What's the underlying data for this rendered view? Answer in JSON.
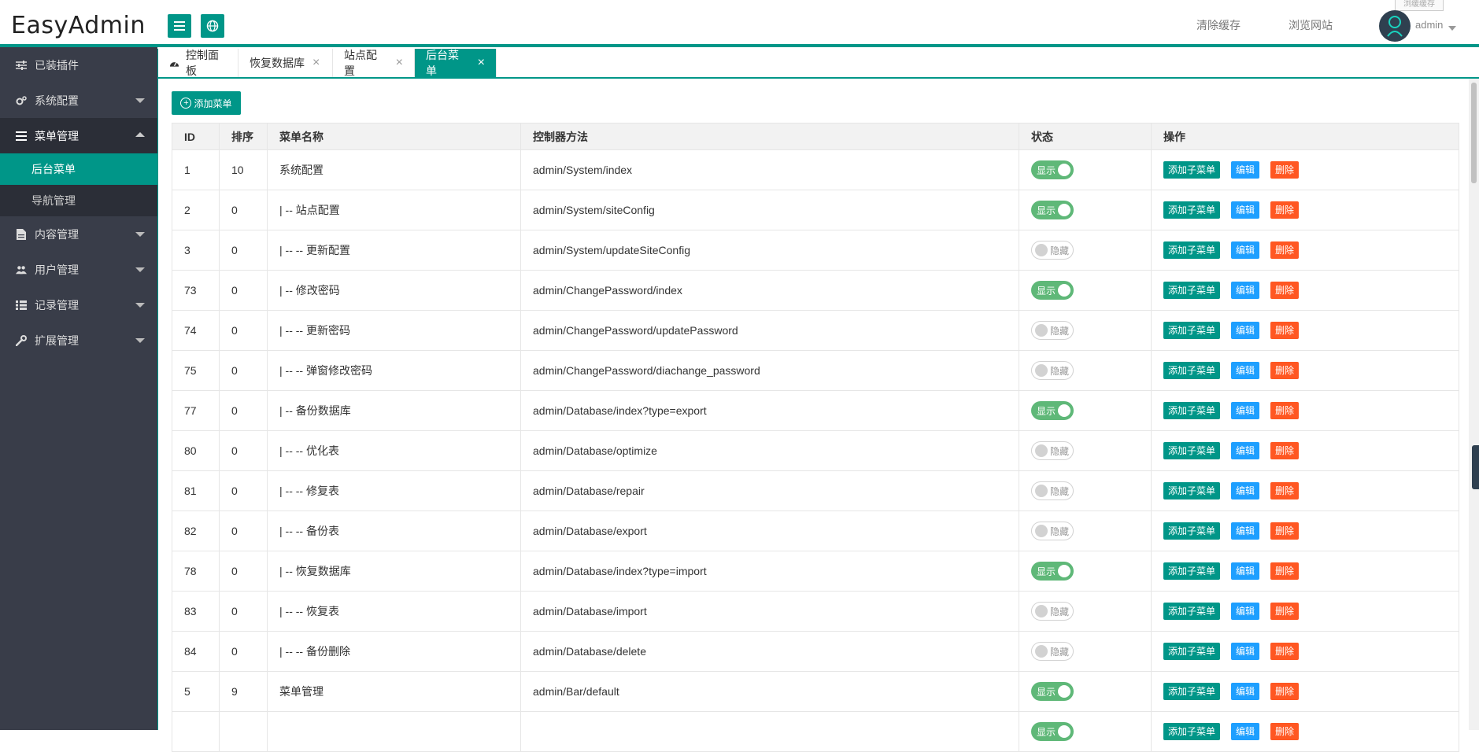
{
  "header": {
    "logo": "EasyAdmin",
    "clear_cache": "清除缓存",
    "browse_site": "浏览网站",
    "username": "admin",
    "tooltip": "浏缓缓存"
  },
  "sidebar": {
    "items": [
      {
        "label": "已装插件",
        "icon": "sliders-icon"
      },
      {
        "label": "系统配置",
        "icon": "gears-icon"
      },
      {
        "label": "菜单管理",
        "icon": "bars-icon"
      },
      {
        "label": "内容管理",
        "icon": "file-icon"
      },
      {
        "label": "用户管理",
        "icon": "users-icon"
      },
      {
        "label": "记录管理",
        "icon": "grid-icon"
      },
      {
        "label": "扩展管理",
        "icon": "wrench-icon"
      }
    ],
    "sub_items": [
      {
        "label": "后台菜单"
      },
      {
        "label": "导航管理"
      }
    ]
  },
  "tabs": [
    {
      "label": "控制面板"
    },
    {
      "label": "恢复数据库"
    },
    {
      "label": "站点配置"
    },
    {
      "label": "后台菜单"
    }
  ],
  "toolbar": {
    "add_menu": "添加菜单"
  },
  "table": {
    "headers": [
      "ID",
      "排序",
      "菜单名称",
      "控制器方法",
      "状态",
      "操作"
    ],
    "switch_on": "显示",
    "switch_off": "隐藏",
    "actions": {
      "add_child": "添加子菜单",
      "edit": "编辑",
      "delete": "删除"
    },
    "rows": [
      {
        "id": "1",
        "sort": "10",
        "name": "系统配置",
        "method": "admin/System/index",
        "on": true
      },
      {
        "id": "2",
        "sort": "0",
        "name": "| -- 站点配置",
        "method": "admin/System/siteConfig",
        "on": true
      },
      {
        "id": "3",
        "sort": "0",
        "name": "| -- -- 更新配置",
        "method": "admin/System/updateSiteConfig",
        "on": false
      },
      {
        "id": "73",
        "sort": "0",
        "name": "| -- 修改密码",
        "method": "admin/ChangePassword/index",
        "on": true
      },
      {
        "id": "74",
        "sort": "0",
        "name": "| -- -- 更新密码",
        "method": "admin/ChangePassword/updatePassword",
        "on": false
      },
      {
        "id": "75",
        "sort": "0",
        "name": "| -- -- 弹窗修改密码",
        "method": "admin/ChangePassword/diachange_password",
        "on": false
      },
      {
        "id": "77",
        "sort": "0",
        "name": "| -- 备份数据库",
        "method": "admin/Database/index?type=export",
        "on": true
      },
      {
        "id": "80",
        "sort": "0",
        "name": "| -- -- 优化表",
        "method": "admin/Database/optimize",
        "on": false
      },
      {
        "id": "81",
        "sort": "0",
        "name": "| -- -- 修复表",
        "method": "admin/Database/repair",
        "on": false
      },
      {
        "id": "82",
        "sort": "0",
        "name": "| -- -- 备份表",
        "method": "admin/Database/export",
        "on": false
      },
      {
        "id": "78",
        "sort": "0",
        "name": "| -- 恢复数据库",
        "method": "admin/Database/index?type=import",
        "on": true
      },
      {
        "id": "83",
        "sort": "0",
        "name": "| -- -- 恢复表",
        "method": "admin/Database/import",
        "on": false
      },
      {
        "id": "84",
        "sort": "0",
        "name": "| -- -- 备份删除",
        "method": "admin/Database/delete",
        "on": false
      },
      {
        "id": "5",
        "sort": "9",
        "name": "菜单管理",
        "method": "admin/Bar/default",
        "on": true
      },
      {
        "id": "",
        "sort": "",
        "name": "",
        "method": "",
        "on": true
      }
    ]
  },
  "colors": {
    "accent": "#009688",
    "sidebar": "#393d49",
    "switch_on": "#5fb878",
    "edit": "#1e9fff",
    "delete": "#ff5722"
  }
}
